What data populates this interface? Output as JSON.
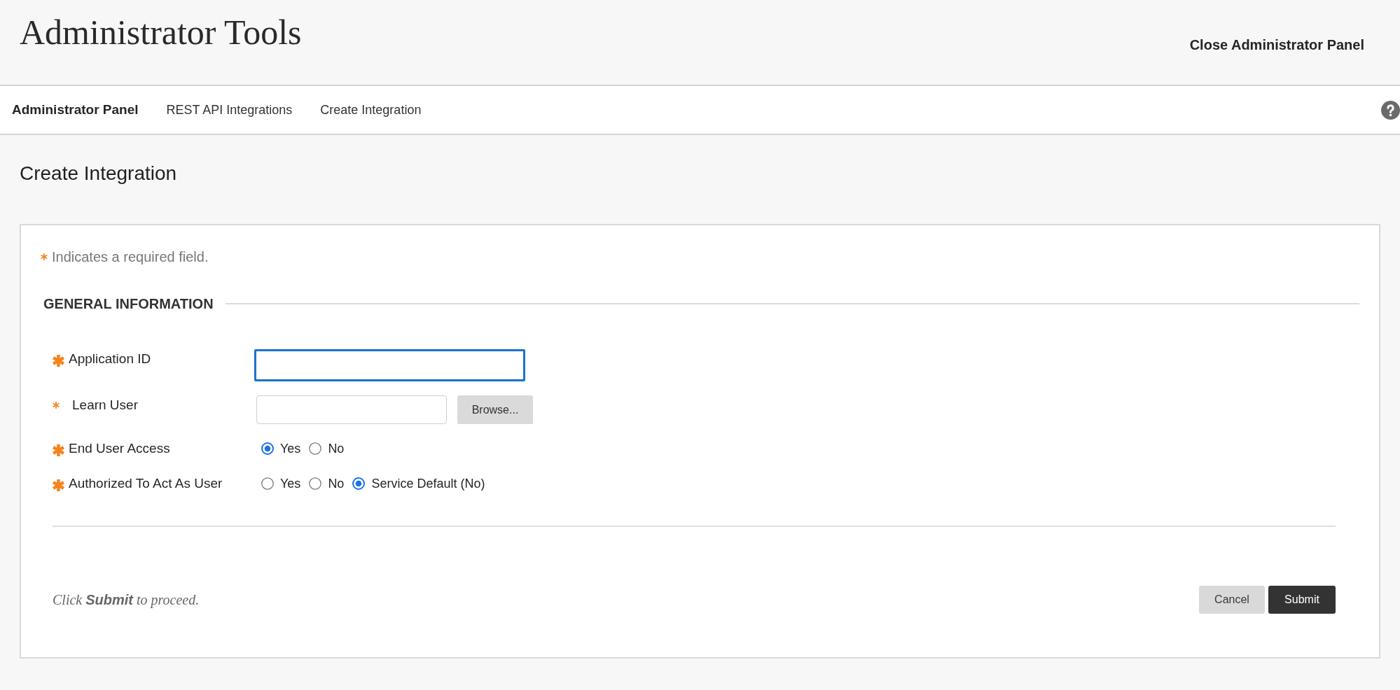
{
  "header": {
    "title": "Administrator Tools",
    "close_link": "Close Administrator Panel"
  },
  "breadcrumbs": [
    {
      "label": "Administrator Panel",
      "kind": "root"
    },
    {
      "label": "REST API Integrations",
      "kind": "link"
    },
    {
      "label": "Create Integration",
      "kind": "link"
    }
  ],
  "page_title": "Create Integration",
  "form": {
    "note": "Indicates a required field.",
    "section_title": "GENERAL INFORMATION",
    "fields": [
      {
        "kind": "text",
        "label": "Application ID",
        "required": true,
        "required_mark": {
          "kind": "heavy"
        },
        "focused": true
      },
      {
        "kind": "lookup",
        "label": "Learn User",
        "required": true,
        "required_mark": {
          "kind": "light"
        },
        "focused": false,
        "button": "Browse..."
      },
      {
        "kind": "radio",
        "label": "End User Access",
        "required": true,
        "required_mark": {
          "kind": "heavy"
        },
        "options": [
          {
            "label": "Yes",
            "selected": true
          },
          {
            "label": "No",
            "selected": false
          }
        ]
      },
      {
        "kind": "radio",
        "label": "Authorized To Act As User",
        "required": true,
        "required_mark": {
          "kind": "heavy"
        },
        "options": [
          {
            "label": "Yes",
            "selected": false
          },
          {
            "label": "No",
            "selected": false
          },
          {
            "label": "Service Default (No)",
            "selected": true
          }
        ]
      }
    ],
    "instruction": "Click **Submit** to proceed.",
    "buttons": [
      {
        "label": "Cancel",
        "kind": "secondary"
      },
      {
        "label": "Submit",
        "kind": "primary"
      }
    ]
  }
}
